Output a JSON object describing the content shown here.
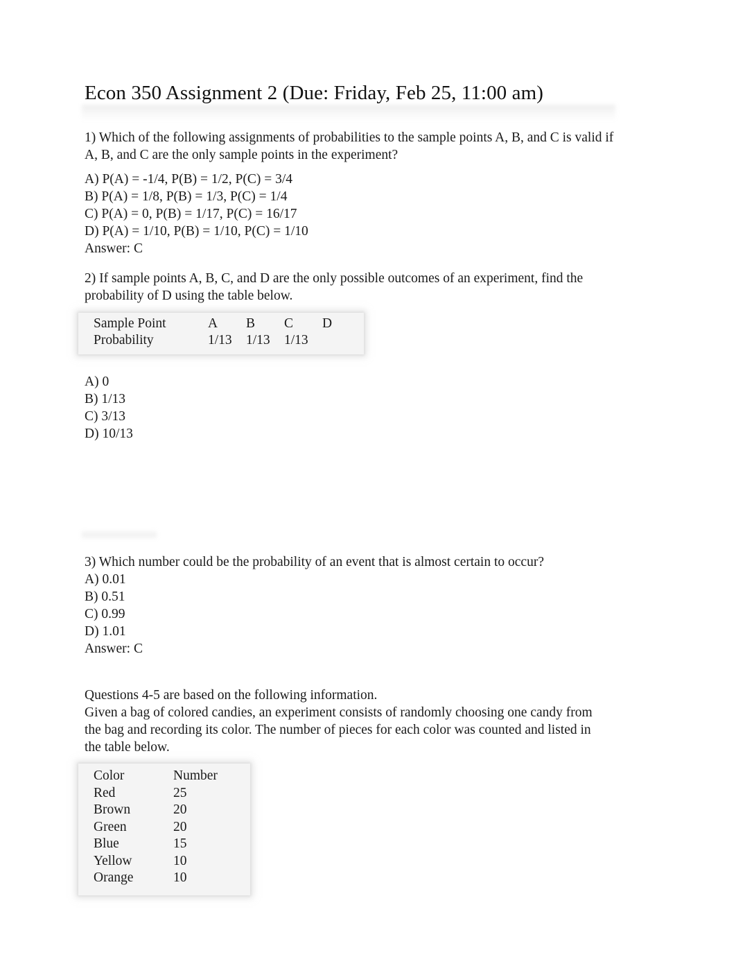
{
  "document": {
    "title": "Econ 350 Assignment 2 (Due: Friday, Feb 25, 11:00 am)"
  },
  "q1": {
    "stem_line1": "1) Which of the following assignments of probabilities to the sample points A, B, and C is valid if",
    "stem_line2": "A, B, and C are the only sample points in the experiment?",
    "options": [
      "A) P(A) = -1/4, P(B) = 1/2, P(C) = 3/4",
      "B) P(A) = 1/8, P(B) = 1/3, P(C) = 1/4",
      "C) P(A) = 0, P(B) = 1/17, P(C) = 16/17",
      "D) P(A) = 1/10, P(B) = 1/10, P(C) = 1/10"
    ],
    "answer": "Answer: C"
  },
  "q2": {
    "stem_line1": "2) If sample points A, B, C, and D are the only possible outcomes of an experiment, find the",
    "stem_line2": "probability of D using the table below.",
    "table": {
      "row_labels": [
        "Sample Point",
        "Probability"
      ],
      "sample_points": [
        "A",
        "B",
        "C",
        "D"
      ],
      "probabilities": [
        "1/13",
        "1/13",
        "1/13",
        ""
      ]
    },
    "options": [
      "A) 0",
      "B) 1/13",
      "C) 3/13",
      "D) 10/13"
    ]
  },
  "q3": {
    "stem": "3) Which number could be the probability of an event that is almost certain to occur?",
    "options": [
      "A) 0.01",
      "B) 0.51",
      "C) 0.99",
      "D) 1.01"
    ],
    "answer": "Answer: C"
  },
  "q45": {
    "intro_line1": "Questions 4-5 are based on the following information.",
    "intro_line2": "Given a bag of colored candies, an experiment consists of randomly choosing one candy from",
    "intro_line3": "the bag and recording its color. The number of pieces for each color was counted and listed in",
    "intro_line4": "the table below.",
    "table": {
      "headers": [
        "Color",
        "Number"
      ],
      "rows": [
        [
          "Red",
          "25"
        ],
        [
          "Brown",
          "20"
        ],
        [
          "Green",
          "20"
        ],
        [
          "Blue",
          "15"
        ],
        [
          "Yellow",
          "10"
        ],
        [
          "Orange",
          "10"
        ]
      ]
    }
  }
}
